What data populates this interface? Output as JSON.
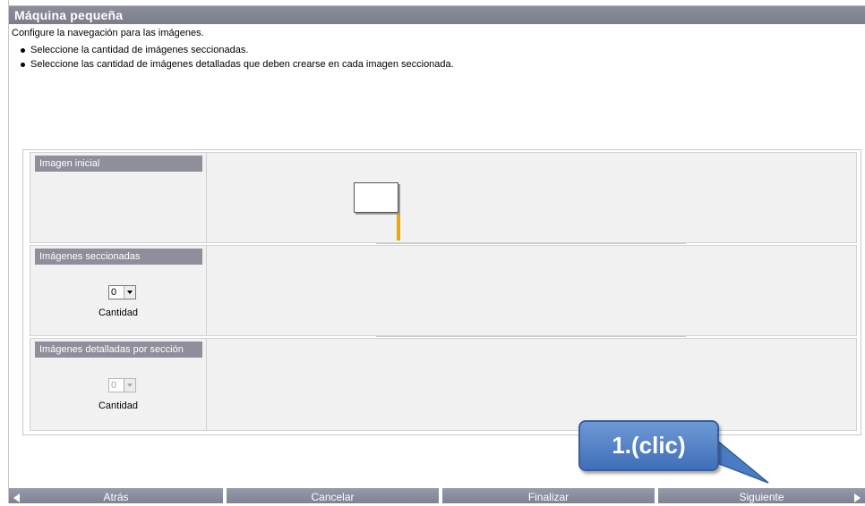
{
  "window": {
    "title": "Máquina pequeña"
  },
  "intro": {
    "text": "Configure la navegación para las imágenes.",
    "bullets": [
      "Seleccione la cantidad de imágenes seccionadas.",
      "Seleccione las cantidad de imágenes detalladas que deben crearse en cada imagen seccionada."
    ]
  },
  "panels": {
    "initial": {
      "header": "Imagen inicial"
    },
    "sections": {
      "header": "Imágenes seccionadas",
      "select_value": "0",
      "label": "Cantidad"
    },
    "details": {
      "header": "Imágenes detalladas por sección",
      "select_value": "0",
      "label": "Cantidad"
    }
  },
  "buttons": {
    "back": "Atrás",
    "cancel": "Cancelar",
    "finish": "Finalizar",
    "next": "Siguiente"
  },
  "callout": {
    "text": "1.(clic)"
  },
  "colors": {
    "accent": "#f0a500",
    "title_bar": "#7d7e8c",
    "callout": "#4a7cc4"
  },
  "icons": {
    "back": "triangle-left-icon",
    "next": "triangle-right-icon"
  }
}
